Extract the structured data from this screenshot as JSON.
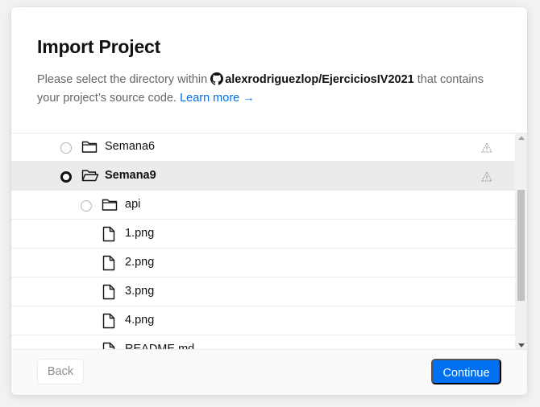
{
  "dialog": {
    "title": "Import Project",
    "description_prefix": "Please select the directory within",
    "repo_name": "alexrodriguezlop/EjerciciosIV2021",
    "description_suffix": "that contains your project’s source code.",
    "learn_more": "Learn more →",
    "github_icon": "github-icon"
  },
  "tree": {
    "items": [
      {
        "label": "Semana6",
        "type": "folder",
        "radio": "unchecked",
        "warning_icon": "warning-icon"
      },
      {
        "label": "Semana9",
        "type": "folder-open",
        "radio": "checked",
        "selected": true,
        "warning_icon": "warning-icon"
      },
      {
        "label": "api",
        "type": "folder",
        "radio": "unchecked"
      },
      {
        "label": "1.png",
        "type": "file"
      },
      {
        "label": "2.png",
        "type": "file"
      },
      {
        "label": "3.png",
        "type": "file"
      },
      {
        "label": "4.png",
        "type": "file"
      },
      {
        "label": "README.md",
        "type": "file"
      }
    ]
  },
  "footer": {
    "back_label": "Back",
    "continue_label": "Continue"
  },
  "colors": {
    "accent": "#0070f3",
    "selected_row": "#ebebeb"
  }
}
